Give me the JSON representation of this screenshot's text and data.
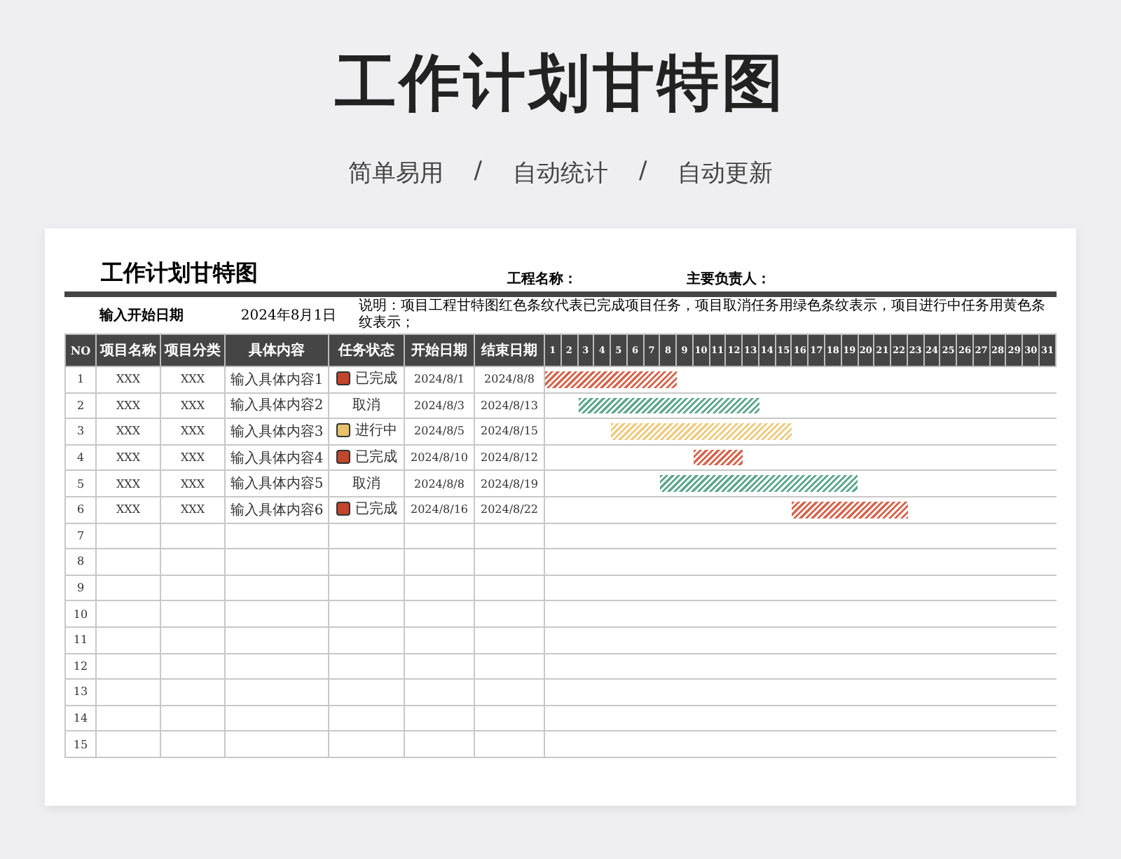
{
  "page_title": "工作计划甘特图",
  "subtitle": [
    "简单易用",
    "/",
    "自动统计",
    "/",
    "自动更新"
  ],
  "sheet": {
    "title": "工作计划甘特图",
    "project_name_label": "工程名称：",
    "owner_label": "主要负责人：",
    "start_label": "输入开始日期",
    "start_value": "2024年8月1日",
    "note": "说明：项目工程甘特图红色条纹代表已完成项目任务，项目取消任务用绿色条纹表示，项目进行中任务用黄色条纹表示；"
  },
  "columns": [
    "NO",
    "项目名称",
    "项目分类",
    "具体内容",
    "任务状态",
    "开始日期",
    "结束日期"
  ],
  "days": [
    "1",
    "2",
    "3",
    "4",
    "5",
    "6",
    "7",
    "8",
    "9",
    "10",
    "11",
    "12",
    "13",
    "14",
    "15",
    "16",
    "17",
    "18",
    "19",
    "20",
    "21",
    "22",
    "23",
    "24",
    "25",
    "26",
    "27",
    "28",
    "29",
    "30",
    "31"
  ],
  "rows": [
    {
      "no": "1",
      "name": "XXX",
      "category": "XXX",
      "content": "输入具体内容1",
      "status": {
        "kind": "done",
        "label": "已完成",
        "color": "#c0462c"
      },
      "start": "2024/8/1",
      "end": "2024/8/8"
    },
    {
      "no": "2",
      "name": "XXX",
      "category": "XXX",
      "content": "输入具体内容2",
      "status": {
        "kind": "cancelled",
        "label": "取消"
      },
      "start": "2024/8/3",
      "end": "2024/8/13"
    },
    {
      "no": "3",
      "name": "XXX",
      "category": "XXX",
      "content": "输入具体内容3",
      "status": {
        "kind": "in_progress",
        "label": "进行中",
        "color": "#e8c26a"
      },
      "start": "2024/8/5",
      "end": "2024/8/15"
    },
    {
      "no": "4",
      "name": "XXX",
      "category": "XXX",
      "content": "输入具体内容4",
      "status": {
        "kind": "done",
        "label": "已完成",
        "color": "#c0462c"
      },
      "start": "2024/8/10",
      "end": "2024/8/12"
    },
    {
      "no": "5",
      "name": "XXX",
      "category": "XXX",
      "content": "输入具体内容5",
      "status": {
        "kind": "cancelled",
        "label": "取消"
      },
      "start": "2024/8/8",
      "end": "2024/8/19"
    },
    {
      "no": "6",
      "name": "XXX",
      "category": "XXX",
      "content": "输入具体内容6",
      "status": {
        "kind": "done",
        "label": "已完成",
        "color": "#c0462c"
      },
      "start": "2024/8/16",
      "end": "2024/8/22"
    },
    {
      "no": "7"
    },
    {
      "no": "8"
    },
    {
      "no": "9"
    },
    {
      "no": "10"
    },
    {
      "no": "11"
    },
    {
      "no": "12"
    },
    {
      "no": "13"
    },
    {
      "no": "14"
    },
    {
      "no": "15"
    }
  ]
}
